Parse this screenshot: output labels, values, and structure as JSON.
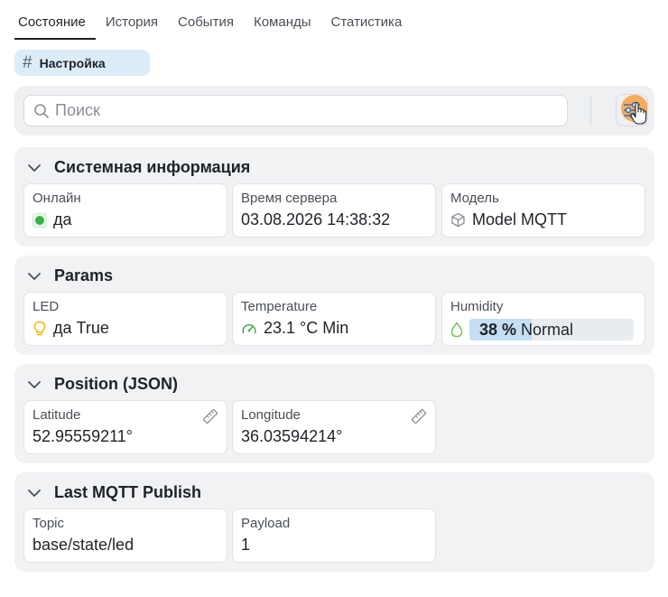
{
  "tabs": [
    {
      "label": "Состояние",
      "active": true
    },
    {
      "label": "История",
      "active": false
    },
    {
      "label": "События",
      "active": false
    },
    {
      "label": "Команды",
      "active": false
    },
    {
      "label": "Статистика",
      "active": false
    }
  ],
  "chip": {
    "icon": "hash-icon",
    "label": "Настройка"
  },
  "search": {
    "placeholder": "Поиск",
    "value": ""
  },
  "sections": {
    "system": {
      "title": "Системная информация",
      "online": {
        "label": "Онлайн",
        "value": "да",
        "status_color": "#3cb043"
      },
      "server_time": {
        "label": "Время сервера",
        "value": "03.08.2026 14:38:32"
      },
      "model": {
        "label": "Модель",
        "value": "Model MQTT",
        "icon": "cube-icon"
      }
    },
    "params": {
      "title": "Params",
      "led": {
        "label": "LED",
        "value": "да True",
        "icon": "bulb-icon",
        "icon_color": "#f0b400"
      },
      "temperature": {
        "label": "Temperature",
        "value": "23.1 °C Min",
        "icon": "gauge-icon",
        "icon_color": "#4caf50"
      },
      "humidity": {
        "label": "Humidity",
        "value_num": "38 %",
        "value_text": "Normal",
        "percent": 38,
        "icon": "drop-icon",
        "icon_color": "#6bbf4e"
      }
    },
    "position": {
      "title": "Position (JSON)",
      "latitude": {
        "label": "Latitude",
        "value": "52.95559211°"
      },
      "longitude": {
        "label": "Longitude",
        "value": "36.03594214°"
      }
    },
    "mqtt": {
      "title": "Last MQTT Publish",
      "topic": {
        "label": "Topic",
        "value": "base/state/led"
      },
      "payload": {
        "label": "Payload",
        "value": "1"
      }
    }
  },
  "colors": {
    "accent_chip": "#dcecf8",
    "cursor_highlight": "#f7a046"
  }
}
